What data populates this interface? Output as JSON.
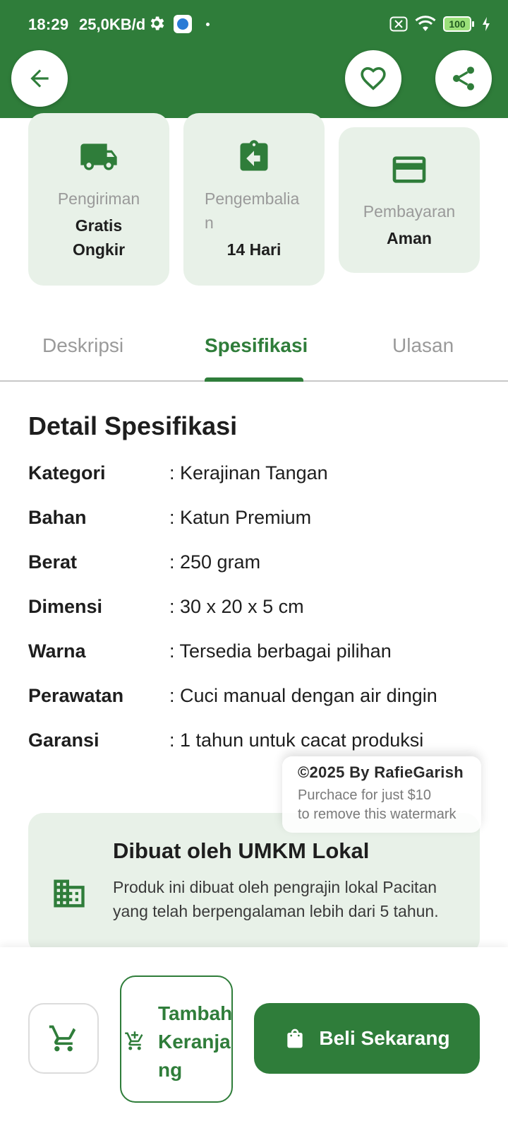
{
  "status_bar": {
    "time": "18:29",
    "speed": "25,0KB/d",
    "battery": "100"
  },
  "header": {
    "background": "#2f7d3a",
    "icons": [
      "back-arrow-icon",
      "heart-icon",
      "share-icon"
    ]
  },
  "features": [
    {
      "icon": "truck-icon",
      "label": "Pengiriman",
      "value": "Gratis Ongkir"
    },
    {
      "icon": "return-icon",
      "label": "Pengembalian",
      "value": "14 Hari"
    },
    {
      "icon": "credit-card-icon",
      "label": "Pembayaran",
      "value": "Aman"
    }
  ],
  "tabs": [
    {
      "label": "Deskripsi",
      "active": false
    },
    {
      "label": "Spesifikasi",
      "active": true
    },
    {
      "label": "Ulasan",
      "active": false
    }
  ],
  "spec": {
    "title": "Detail Spesifikasi",
    "rows": [
      {
        "key": "Kategori",
        "value": ": Kerajinan Tangan"
      },
      {
        "key": "Bahan",
        "value": ": Katun Premium"
      },
      {
        "key": "Berat",
        "value": ": 250 gram"
      },
      {
        "key": "Dimensi",
        "value": ": 30 x 20 x 5 cm"
      },
      {
        "key": "Warna",
        "value": ": Tersedia berbagai pilihan"
      },
      {
        "key": "Perawatan",
        "value": ": Cuci manual dengan air dingin"
      },
      {
        "key": "Garansi",
        "value": ": 1 tahun untuk cacat produksi"
      }
    ]
  },
  "watermark": {
    "line1": "©2025 By RafieGarish",
    "line2": "Purchace for just $10",
    "line3": "to remove this watermark"
  },
  "umkm": {
    "icon": "building-icon",
    "title": "Dibuat oleh UMKM Lokal",
    "description": "Produk ini dibuat oleh pengrajin lokal Pacitan yang telah berpengalaman lebih dari 5 tahun."
  },
  "bottom": {
    "add_to_cart": "Tambah Keranjang",
    "buy_now": "Beli Sekarang"
  },
  "colors": {
    "primary": "#2f7d3a",
    "card_bg": "#e8f1e8",
    "muted_text": "#9a9a9a"
  }
}
